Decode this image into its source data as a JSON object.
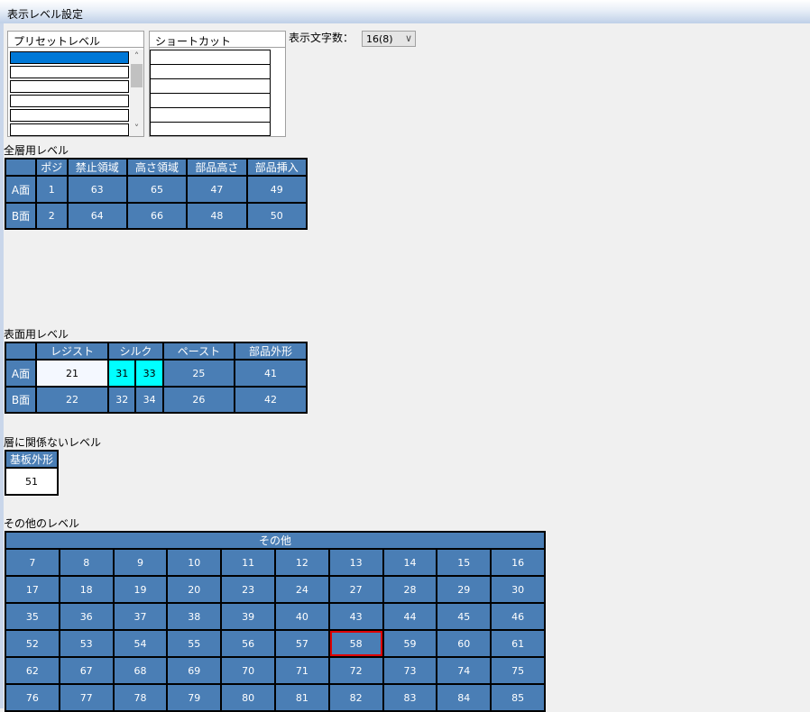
{
  "window": {
    "title": "表示レベル設定"
  },
  "preset": {
    "header": "プリセットレベル",
    "rows": 6
  },
  "shortcut": {
    "header": "ショートカット",
    "rows": 6
  },
  "display_chars": {
    "label": "表示文字数：",
    "value": "16(8)"
  },
  "all_layers": {
    "title": "全層用レベル",
    "headers": [
      "ポジ",
      "禁止領域",
      "高さ領域",
      "部品高さ",
      "部品挿入"
    ],
    "rows": [
      {
        "label": "A面",
        "values": [
          "1",
          "63",
          "65",
          "47",
          "49"
        ]
      },
      {
        "label": "B面",
        "values": [
          "2",
          "64",
          "66",
          "48",
          "50"
        ]
      }
    ]
  },
  "surface": {
    "title": "表面用レベル",
    "headers": [
      "レジスト",
      "シルク",
      "ペースト",
      "部品外形"
    ],
    "rows": [
      {
        "label": "A面",
        "values": [
          "21",
          "31",
          "33",
          "25",
          "41"
        ]
      },
      {
        "label": "B面",
        "values": [
          "22",
          "32",
          "34",
          "26",
          "42"
        ]
      }
    ]
  },
  "independent": {
    "title": "層に関係ないレベル",
    "header": "基板外形",
    "value": "51"
  },
  "other": {
    "title": "その他のレベル",
    "header": "その他",
    "rows": [
      [
        "7",
        "8",
        "9",
        "10",
        "11",
        "12",
        "13",
        "14",
        "15",
        "16"
      ],
      [
        "17",
        "18",
        "19",
        "20",
        "23",
        "24",
        "27",
        "28",
        "29",
        "30"
      ],
      [
        "35",
        "36",
        "37",
        "38",
        "39",
        "40",
        "43",
        "44",
        "45",
        "46"
      ],
      [
        "52",
        "53",
        "54",
        "55",
        "56",
        "57",
        "58",
        "59",
        "60",
        "61"
      ],
      [
        "62",
        "67",
        "68",
        "69",
        "70",
        "71",
        "72",
        "73",
        "74",
        "75"
      ],
      [
        "76",
        "77",
        "78",
        "79",
        "80",
        "81",
        "82",
        "83",
        "84",
        "85"
      ]
    ],
    "selected": "58"
  },
  "colors": {
    "cell": "#4a7eb5",
    "highlight": "#00ffff",
    "selected_border": "#e00000",
    "list_selection": "#0078d7"
  }
}
